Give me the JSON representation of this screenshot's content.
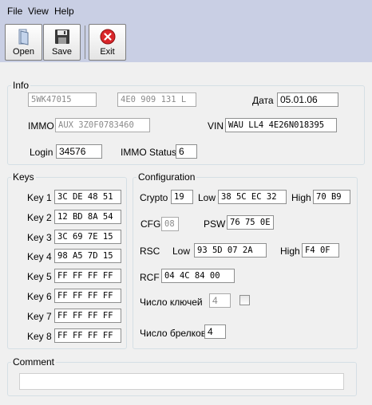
{
  "menu": {
    "file": "File",
    "view": "View",
    "help": "Help"
  },
  "toolbar": {
    "open": "Open",
    "save": "Save",
    "exit": "Exit"
  },
  "info": {
    "title": "Info",
    "field1": "5WK47015",
    "field2": "4E0 909 131 L",
    "date_label": "Дата",
    "date": "05.01.06",
    "immo_label": "IMMO",
    "immo": "AUX 3Z0F0783460",
    "vin_label": "VIN",
    "vin": "WAU LL4 4E26N018395",
    "login_label": "Login",
    "login": "34576",
    "immo_status_label": "IMMO Status",
    "immo_status": "6"
  },
  "keys": {
    "title": "Keys",
    "items": [
      {
        "label": "Key 1",
        "value": "3C DE 48 51"
      },
      {
        "label": "Key 2",
        "value": "12 BD 8A 54"
      },
      {
        "label": "Key 3",
        "value": "3C 69 7E 15"
      },
      {
        "label": "Key 4",
        "value": "98 A5 7D 15"
      },
      {
        "label": "Key 5",
        "value": "FF FF FF FF"
      },
      {
        "label": "Key 6",
        "value": "FF FF FF FF"
      },
      {
        "label": "Key 7",
        "value": "FF FF FF FF"
      },
      {
        "label": "Key 8",
        "value": "FF FF FF FF"
      }
    ]
  },
  "config": {
    "title": "Configuration",
    "crypto_label": "Crypto",
    "crypto": "19",
    "low_label": "Low",
    "crypto_low": "38 5C EC 32",
    "high_label": "High",
    "crypto_high": "70 B9",
    "cfg_label": "CFG",
    "cfg": "08",
    "psw_label": "PSW",
    "psw": "76 75 0E",
    "rsc_label": "RSC",
    "rsc_low": "93 5D 07 2A",
    "rsc_high": "F4 0F",
    "rcf_label": "RCF",
    "rcf": "04 4C 84 00",
    "num_keys_label": "Число ключей",
    "num_keys": "4",
    "num_fobs_label": "Число брелков",
    "num_fobs": "4"
  },
  "comment": {
    "title": "Comment",
    "value": ""
  }
}
